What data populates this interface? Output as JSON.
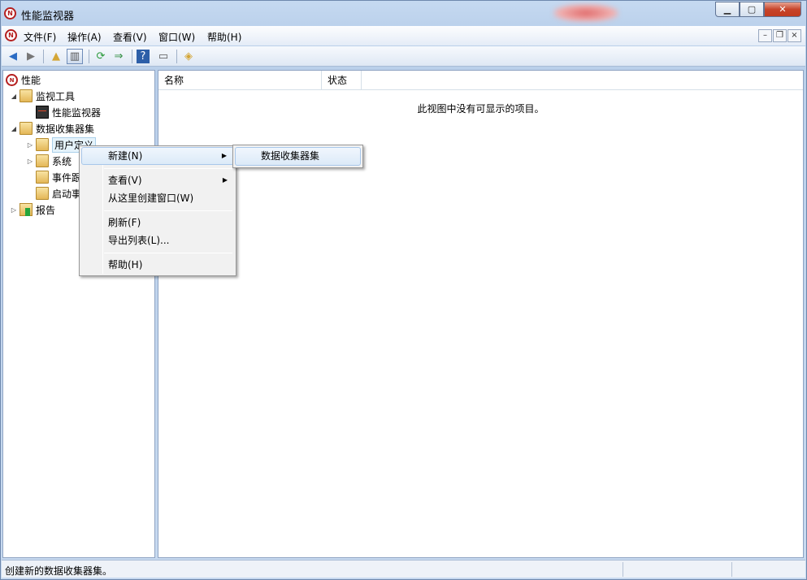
{
  "window": {
    "title": "性能监视器"
  },
  "menubar": {
    "items": [
      "文件(F)",
      "操作(A)",
      "查看(V)",
      "窗口(W)",
      "帮助(H)"
    ]
  },
  "tree": {
    "items": [
      {
        "label": "性能",
        "icon": "performance-icon"
      },
      {
        "label": "监视工具",
        "icon": "folder-tools-icon"
      },
      {
        "label": "性能监视器",
        "icon": "monitor-chart-icon"
      },
      {
        "label": "数据收集器集",
        "icon": "folder-collector-icon"
      },
      {
        "label": "用户定义",
        "icon": "user-folder-icon"
      },
      {
        "label": "系统",
        "icon": "system-folder-icon"
      },
      {
        "label": "事件跟",
        "icon": "folder-icon"
      },
      {
        "label": "启动事",
        "icon": "folder-icon"
      },
      {
        "label": "报告",
        "icon": "report-icon"
      }
    ]
  },
  "list": {
    "columns": [
      "名称",
      "状态"
    ],
    "empty_message": "此视图中没有可显示的项目。"
  },
  "context_menu": {
    "items": [
      {
        "label": "新建(N)"
      },
      {
        "label": "查看(V)"
      },
      {
        "label": "从这里创建窗口(W)"
      },
      {
        "label": "刷新(F)"
      },
      {
        "label": "导出列表(L)..."
      },
      {
        "label": "帮助(H)"
      }
    ],
    "submenu": {
      "items": [
        "数据收集器集"
      ]
    }
  },
  "status": {
    "text": "创建新的数据收集器集。"
  }
}
